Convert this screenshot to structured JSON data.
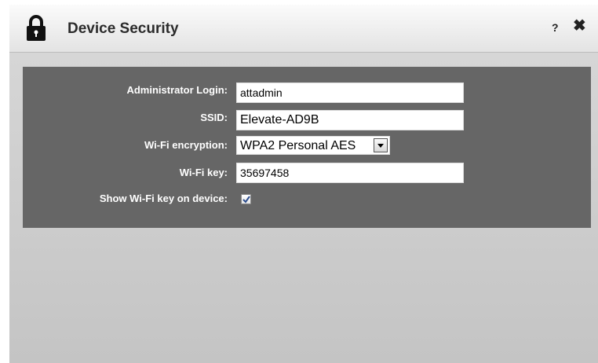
{
  "dialog": {
    "title": "Device Security",
    "help": "?",
    "close": "✖",
    "icons": {
      "lock": "lock-icon",
      "help": "question-mark-icon",
      "close": "close-icon"
    }
  },
  "form": {
    "admin_login": {
      "label": "Administrator Login:",
      "value": "attadmin"
    },
    "ssid": {
      "label": "SSID:",
      "value": "Elevate-AD9B"
    },
    "encryption": {
      "label": "Wi-Fi encryption:",
      "value": "WPA2 Personal AES"
    },
    "wifi_key": {
      "label": "Wi-Fi key:",
      "value": "35697458"
    },
    "show_key": {
      "label": "Show Wi-Fi key on device:",
      "checked": true
    }
  },
  "colors": {
    "panel": "#666666",
    "background": "#cfcfcf",
    "title_text": "#2b2b2b",
    "checkmark": "#2a4b8c"
  }
}
